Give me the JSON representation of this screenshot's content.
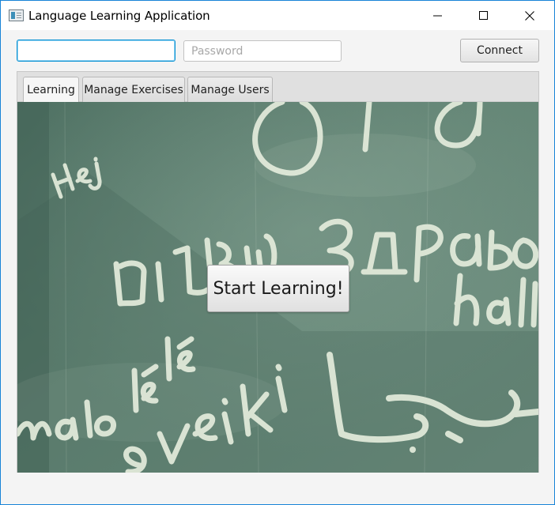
{
  "window": {
    "title": "Language Learning Application"
  },
  "login": {
    "username_value": "",
    "password_placeholder": "Password",
    "connect_label": "Connect"
  },
  "tabs": [
    {
      "label": "Learning",
      "selected": true
    },
    {
      "label": "Manage Exercises",
      "selected": false
    },
    {
      "label": "Manage Users",
      "selected": false
    }
  ],
  "learning": {
    "background_words": [
      "Olá",
      "Hej",
      "שלום",
      "здраво",
      "hallo",
      "malo lē lē",
      "sveiki",
      "مرحبا"
    ],
    "start_label": "Start Learning!"
  },
  "colors": {
    "window_border": "#1883d7",
    "focus_border": "#0b93d4",
    "chalkboard": "#5b7b6e",
    "chalk": "#e4ecdc"
  },
  "icons": {
    "app": "app-window-icon",
    "minimize": "minimize-icon",
    "maximize": "maximize-icon",
    "close": "close-icon"
  }
}
